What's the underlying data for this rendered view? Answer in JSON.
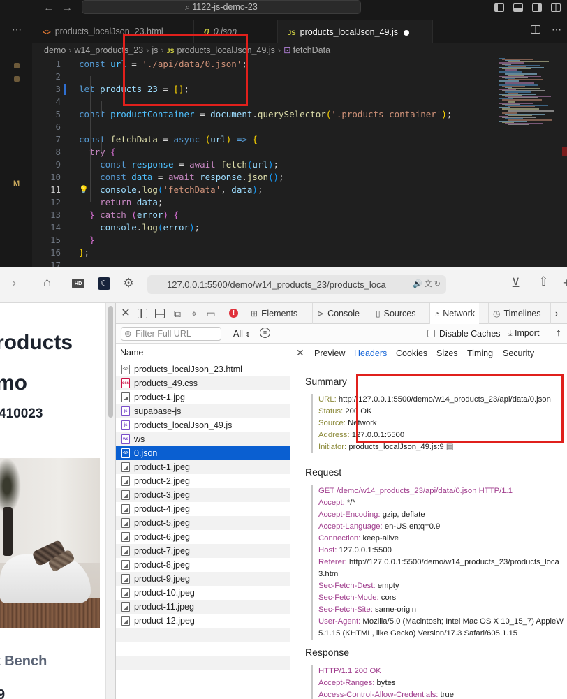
{
  "vscode": {
    "command_center": "1122-js-demo-23",
    "tabs": [
      {
        "label": "products_localJson_23.html",
        "type": "html",
        "icon": "html-icon"
      },
      {
        "label": "0.json",
        "type": "json",
        "icon": "json-icon"
      },
      {
        "label": "products_localJson_49.js",
        "type": "js",
        "icon": "js-icon",
        "active": true,
        "modified": true
      }
    ],
    "breadcrumb": [
      "demo",
      "w14_products_23",
      "js",
      "products_localJson_49.js",
      "fetchData"
    ],
    "activity_badge": "M",
    "code_lines": [
      {
        "n": "1",
        "html": "<span class='kw'>const</span> <span class='const'>url</span> = <span class='str'>'./api/data/0.json'</span>;"
      },
      {
        "n": "2",
        "html": ""
      },
      {
        "n": "3",
        "html": "<span class='kw'>let</span> <span class='var'>products_23</span> = <span class='br1'>[]</span>;"
      },
      {
        "n": "4",
        "html": ""
      },
      {
        "n": "5",
        "html": "<span class='kw'>const</span> <span class='const'>productContainer</span> = <span class='var'>document</span>.<span class='fnc'>querySelector</span><span class='br1'>(</span><span class='str'>'.products-container'</span><span class='br1'>)</span>;"
      },
      {
        "n": "6",
        "html": ""
      },
      {
        "n": "7",
        "html": "<span class='kw'>const</span> <span class='fnc'>fetchData</span> = <span class='kw'>async</span> <span class='br1'>(</span><span class='var'>url</span><span class='br1'>)</span> <span class='kw'>=&gt;</span> <span class='br1'>{</span>"
      },
      {
        "n": "8",
        "html": "  <span class='kw2'>try</span> <span class='br2'>{</span>"
      },
      {
        "n": "9",
        "html": "    <span class='kw'>const</span> <span class='const'>response</span> = <span class='kw2'>await</span> <span class='fnc'>fetch</span><span class='br3'>(</span><span class='var'>url</span><span class='br3'>)</span>;"
      },
      {
        "n": "10",
        "html": "    <span class='kw'>const</span> <span class='const'>data</span> = <span class='kw2'>await</span> <span class='var'>response</span>.<span class='fnc'>json</span><span class='br3'>()</span>;"
      },
      {
        "n": "11",
        "html": "    <span class='var'>console</span>.<span class='fnc'>log</span><span class='br3'>(</span><span class='str'>'fetchData'</span>, <span class='var'>data</span><span class='br3'>)</span>;",
        "current": true
      },
      {
        "n": "12",
        "html": "    <span class='kw2'>return</span> <span class='var'>data</span>;"
      },
      {
        "n": "13",
        "html": "  <span class='br2'>}</span> <span class='kw2'>catch</span> <span class='br2'>(</span><span class='var'>error</span><span class='br2'>)</span> <span class='br2'>{</span>"
      },
      {
        "n": "14",
        "html": "    <span class='var'>console</span>.<span class='fnc'>log</span><span class='br3'>(</span><span class='var'>error</span><span class='br3'>)</span>;"
      },
      {
        "n": "15",
        "html": "  <span class='br2'>}</span>"
      },
      {
        "n": "16",
        "html": "<span class='br1'>}</span>;"
      },
      {
        "n": "17",
        "html": ""
      }
    ]
  },
  "safari": {
    "address": "127.0.0.1:5500/demo/w14_products_23/products_loca",
    "badges": {
      "hd": "HD"
    }
  },
  "page": {
    "title_line1": "roducts",
    "title_line2": "mo",
    "id_text": "410023",
    "product_name": "t Bench",
    "price": "9"
  },
  "devtools": {
    "tabs": [
      {
        "label": "Elements",
        "icon": "elements-icon"
      },
      {
        "label": "Console",
        "icon": "console-icon"
      },
      {
        "label": "Sources",
        "icon": "sources-icon"
      },
      {
        "label": "Network",
        "icon": "network-icon",
        "active": true
      },
      {
        "label": "Timelines",
        "icon": "timelines-icon"
      }
    ],
    "filter_placeholder": "Filter Full URL",
    "filter_type": "All",
    "disable_caches": "Disable Caches",
    "import": "Import",
    "list_header": "Name",
    "requests": [
      {
        "name": "products_localJson_23.html",
        "type": "html"
      },
      {
        "name": "products_49.css",
        "type": "css"
      },
      {
        "name": "product-1.jpg",
        "type": "img"
      },
      {
        "name": "supabase-js",
        "type": "js"
      },
      {
        "name": "products_localJson_49.js",
        "type": "js"
      },
      {
        "name": "ws",
        "type": "ws"
      },
      {
        "name": "0.json",
        "type": "json",
        "selected": true
      },
      {
        "name": "product-1.jpeg",
        "type": "img"
      },
      {
        "name": "product-2.jpeg",
        "type": "img"
      },
      {
        "name": "product-3.jpeg",
        "type": "img"
      },
      {
        "name": "product-4.jpeg",
        "type": "img"
      },
      {
        "name": "product-5.jpeg",
        "type": "img"
      },
      {
        "name": "product-6.jpeg",
        "type": "img"
      },
      {
        "name": "product-7.jpeg",
        "type": "img"
      },
      {
        "name": "product-8.jpeg",
        "type": "img"
      },
      {
        "name": "product-9.jpeg",
        "type": "img"
      },
      {
        "name": "product-10.jpeg",
        "type": "img"
      },
      {
        "name": "product-11.jpeg",
        "type": "img"
      },
      {
        "name": "product-12.jpeg",
        "type": "img"
      }
    ],
    "detail_tabs": [
      "Preview",
      "Headers",
      "Cookies",
      "Sizes",
      "Timing",
      "Security"
    ],
    "active_detail_tab": "Headers",
    "summary_title": "Summary",
    "summary": [
      {
        "k": "URL:",
        "v": "http://127.0.0.1:5500/demo/w14_products_23/api/data/0.json"
      },
      {
        "k": "Status:",
        "v": "200 OK"
      },
      {
        "k": "Source:",
        "v": "Network"
      },
      {
        "k": "Address:",
        "v": "127.0.0.1:5500"
      },
      {
        "k": "Initiator:",
        "v": "products_localJson_49.js:9"
      }
    ],
    "request_title": "Request",
    "request_line": "GET /demo/w14_products_23/api/data/0.json HTTP/1.1",
    "request_headers": [
      {
        "k": "Accept:",
        "v": "*/*"
      },
      {
        "k": "Accept-Encoding:",
        "v": "gzip, deflate"
      },
      {
        "k": "Accept-Language:",
        "v": "en-US,en;q=0.9"
      },
      {
        "k": "Connection:",
        "v": "keep-alive"
      },
      {
        "k": "Host:",
        "v": "127.0.0.1:5500"
      },
      {
        "k": "Referer:",
        "v": "http://127.0.0.1:5500/demo/w14_products_23/products_loca",
        "v2": "3.html"
      },
      {
        "k": "Sec-Fetch-Dest:",
        "v": "empty"
      },
      {
        "k": "Sec-Fetch-Mode:",
        "v": "cors"
      },
      {
        "k": "Sec-Fetch-Site:",
        "v": "same-origin"
      },
      {
        "k": "User-Agent:",
        "v": "Mozilla/5.0 (Macintosh; Intel Mac OS X 10_15_7) AppleW",
        "v2": "5.1.15 (KHTML, like Gecko) Version/17.3 Safari/605.1.15"
      }
    ],
    "response_title": "Response",
    "response_line": "HTTP/1.1 200 OK",
    "response_headers": [
      {
        "k": "Accept-Ranges:",
        "v": "bytes"
      },
      {
        "k": "Access-Control-Allow-Credentials:",
        "v": "true"
      }
    ]
  },
  "colors": {
    "highlight_box": "#e0201c",
    "selected_row": "#0a5fd1",
    "active_tab_text": "#1565d8"
  }
}
